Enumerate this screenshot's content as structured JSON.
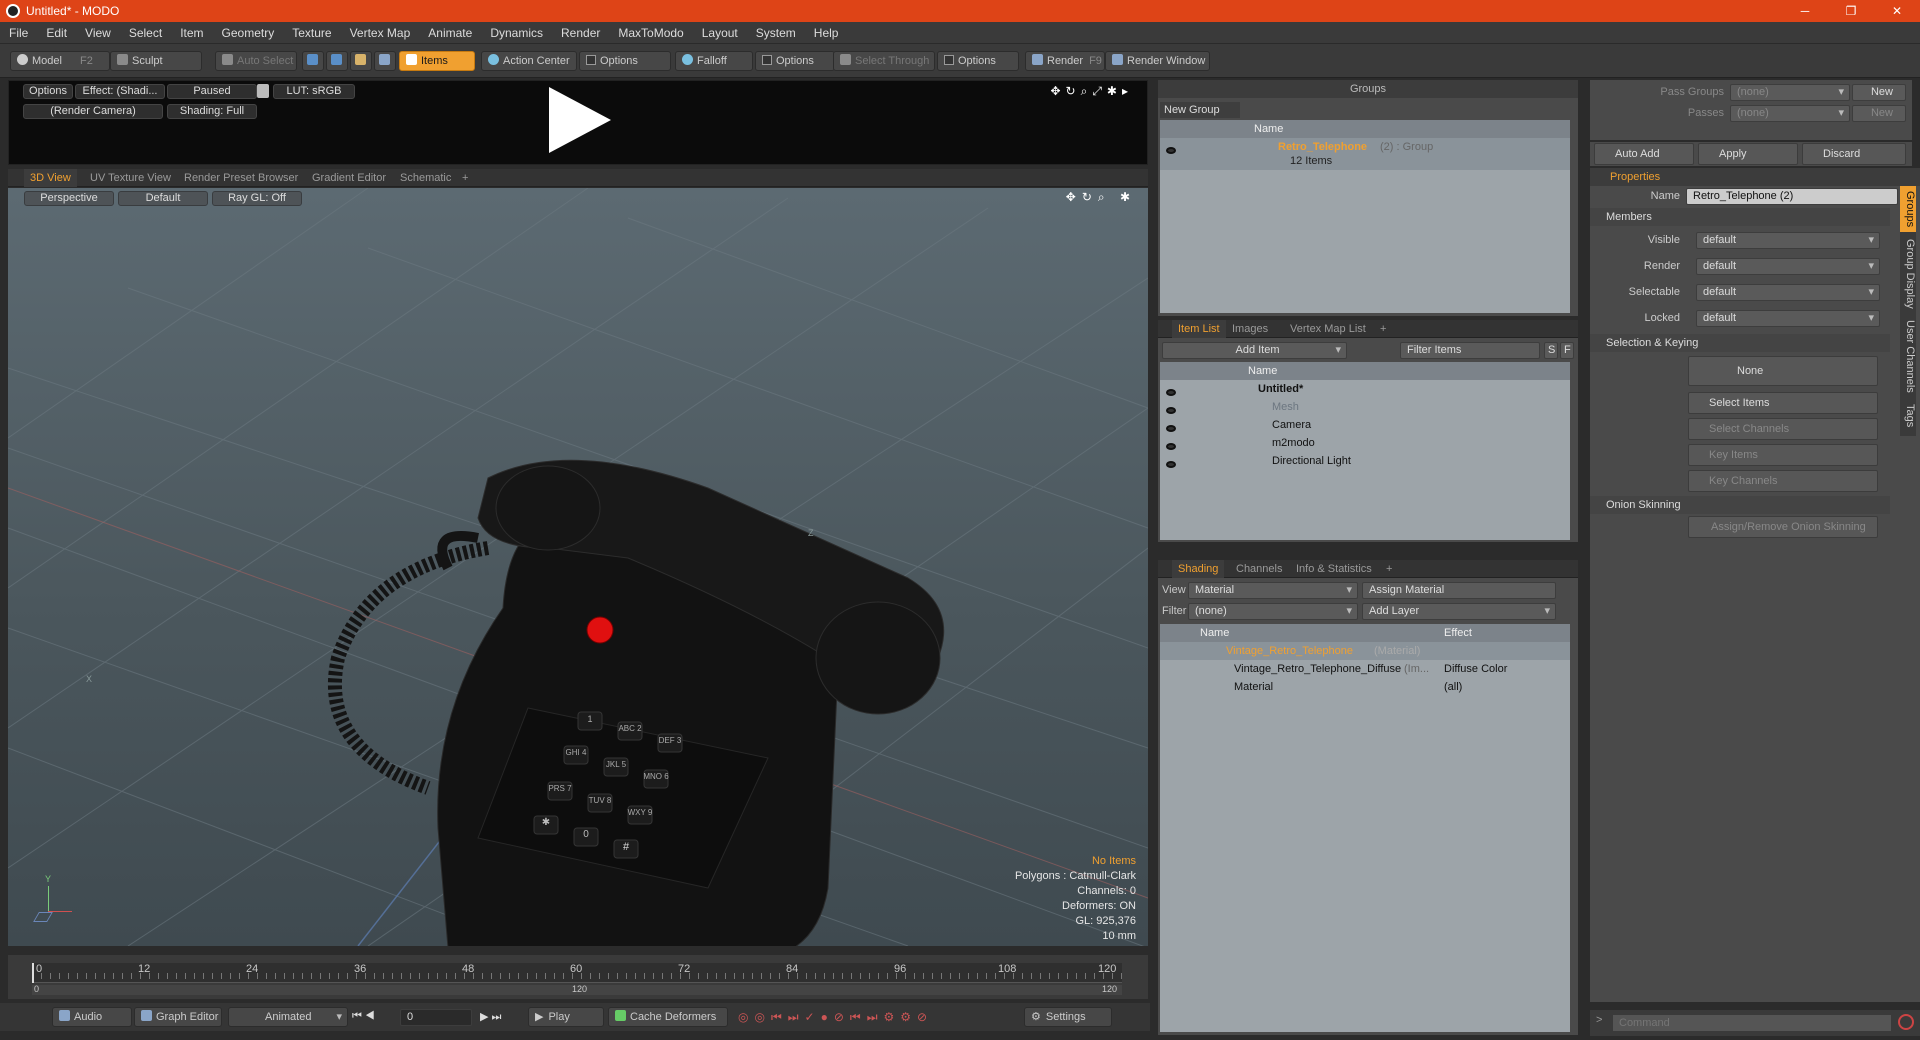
{
  "window": {
    "title": "Untitled* - MODO",
    "min": "─",
    "max": "❐",
    "close": "✕"
  },
  "menu": [
    "File",
    "Edit",
    "View",
    "Select",
    "Item",
    "Geometry",
    "Texture",
    "Vertex Map",
    "Animate",
    "Dynamics",
    "Render",
    "MaxToModo",
    "Layout",
    "System",
    "Help"
  ],
  "toolbar": {
    "model": "Model",
    "model_key": "F2",
    "sculpt": "Sculpt",
    "auto_select": "Auto Select",
    "items": "Items",
    "action_center": "Action Center",
    "options": "Options",
    "falloff": "Falloff",
    "select_through": "Select Through",
    "render": "Render",
    "render_key": "F9",
    "render_window": "Render Window"
  },
  "preview": {
    "options": "Options",
    "effect": "Effect: (Shadi...",
    "paused": "Paused",
    "lut": "LUT: sRGB",
    "camera": "(Render Camera)",
    "shading": "Shading: Full"
  },
  "viewtabs": [
    "3D View",
    "UV Texture View",
    "Render Preset Browser",
    "Gradient Editor",
    "Schematic",
    "+"
  ],
  "viewport": {
    "perspective": "Perspective",
    "default": "Default",
    "raygl": "Ray GL: Off",
    "axis_z": "Z",
    "axis_x": "X",
    "axis_y": "Y",
    "info": {
      "no_items": "No Items",
      "polygons": "Polygons : Catmull-Clark",
      "channels": "Channels: 0",
      "deformers": "Deformers: ON",
      "gl": "GL: 925,376",
      "scale": "10 mm"
    }
  },
  "keys": [
    "1",
    "ABC 2",
    "DEF 3",
    "GHI 4",
    "JKL 5",
    "MNO 6",
    "PRS 7",
    "TUV 8",
    "WXY 9",
    "✱",
    "0",
    "#"
  ],
  "timeline": {
    "ticks": [
      "0",
      "12",
      "24",
      "36",
      "48",
      "60",
      "72",
      "84",
      "96",
      "108",
      "120"
    ],
    "sub_start": "0",
    "sub_mid": "120",
    "sub_end": "120"
  },
  "bottom": {
    "audio": "Audio",
    "graph_editor": "Graph Editor",
    "animated": "Animated",
    "frame": "0",
    "play": "Play",
    "cache": "Cache Deformers",
    "settings": "Settings"
  },
  "groups": {
    "title": "Groups",
    "new_group": "New Group",
    "col_name": "Name",
    "row_name": "Retro_Telephone",
    "row_suffix": "(2) : Group",
    "row_items": "12 Items"
  },
  "itemlist": {
    "tabs": [
      "Item List",
      "Images",
      "Vertex Map List",
      "+"
    ],
    "add_item": "Add Item",
    "filter": "Filter Items",
    "col_name": "Name",
    "s": "S",
    "f": "F",
    "rows": [
      "Untitled*",
      "Mesh",
      "Camera",
      "m2modo",
      "Directional Light"
    ]
  },
  "shading": {
    "tabs": [
      "Shading",
      "Channels",
      "Info & Statistics",
      "+"
    ],
    "view_label": "View",
    "view_value": "Material",
    "assign": "Assign Material",
    "filter_label": "Filter",
    "filter_value": "(none)",
    "add_layer": "Add Layer",
    "col_name": "Name",
    "col_effect": "Effect",
    "rows": [
      {
        "name": "Vintage_Retro_Telephone",
        "suffix": "(Material)",
        "effect": ""
      },
      {
        "name": "Vintage_Retro_Telephone_Diffuse",
        "suffix": "(Im...",
        "effect": "Diffuse Color"
      },
      {
        "name": "Material",
        "suffix": "",
        "effect": "(all)"
      }
    ]
  },
  "passes": {
    "pass_groups": "Pass Groups",
    "passes": "Passes",
    "none": "(none)",
    "new": "New",
    "auto_add": "Auto Add",
    "apply": "Apply",
    "discard": "Discard"
  },
  "props": {
    "tab": "Properties",
    "name_label": "Name",
    "name_value": "Retro_Telephone (2)",
    "members": "Members",
    "visible": "Visible",
    "render": "Render",
    "selectable": "Selectable",
    "locked": "Locked",
    "default": "default",
    "selection_keying": "Selection & Keying",
    "none": "None",
    "select_items": "Select Items",
    "select_channels": "Select Channels",
    "key_items": "Key Items",
    "key_channels": "Key Channels",
    "onion": "Onion Skinning",
    "assign_onion": "Assign/Remove Onion Skinning",
    "vtabs": [
      "Groups",
      "Group Display",
      "User Channels",
      "Tags"
    ]
  },
  "command": {
    "placeholder": "Command"
  }
}
